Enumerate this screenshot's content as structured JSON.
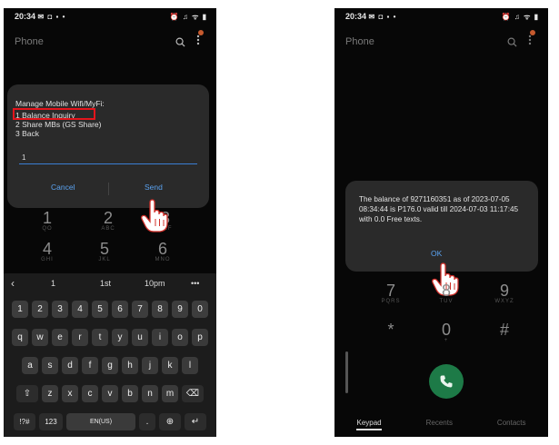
{
  "left": {
    "status": {
      "time": "20:34",
      "left_icons": "✉ ◘ ▪ •",
      "right_icons": "⏰ ♫ ᯤ ▮"
    },
    "app": {
      "title": "Phone"
    },
    "dialog": {
      "title": "Manage Mobile Wifi/MyFi:",
      "options": [
        "1 Balance Inquiry",
        "2 Share MBs (GS Share)",
        "3 Back"
      ],
      "input_value": "1",
      "cancel_label": "Cancel",
      "send_label": "Send"
    },
    "dialpad_visible": [
      {
        "digit": "1",
        "letters": "QO"
      },
      {
        "digit": "2",
        "letters": "ABC"
      },
      {
        "digit": "3",
        "letters": "DEF"
      },
      {
        "digit": "4",
        "letters": "GHI"
      },
      {
        "digit": "5",
        "letters": "JKL"
      },
      {
        "digit": "6",
        "letters": "MNO"
      }
    ],
    "keyboard": {
      "suggestions": [
        "‹",
        "1",
        "1st",
        "10pm",
        "•••"
      ],
      "row_numbers": [
        "1",
        "2",
        "3",
        "4",
        "5",
        "6",
        "7",
        "8",
        "9",
        "0"
      ],
      "row1": [
        "q",
        "w",
        "e",
        "r",
        "t",
        "y",
        "u",
        "i",
        "o",
        "p"
      ],
      "row2": [
        "a",
        "s",
        "d",
        "f",
        "g",
        "h",
        "j",
        "k",
        "l"
      ],
      "row3": [
        "⇧",
        "z",
        "x",
        "c",
        "v",
        "b",
        "n",
        "m",
        "⌫"
      ],
      "row4": [
        "!?#",
        "123",
        "EN(US)",
        ".",
        "⊕",
        "↵"
      ]
    }
  },
  "right": {
    "status": {
      "time": "20:34",
      "left_icons": "✉ ◘ ▪ •",
      "right_icons": "⏰ ♫ ᯤ ▮"
    },
    "app": {
      "title": "Phone"
    },
    "dialog": {
      "message": "The balance of 9271160351 as of 2023-07-05 08:34:44 is P176.0 valid till 2024-07-03 11:17:45 with 0.0 Free texts.",
      "ok_label": "OK"
    },
    "dialpad_visible": [
      {
        "digit": "7",
        "letters": "PQRS"
      },
      {
        "digit": "8",
        "letters": "TUV"
      },
      {
        "digit": "9",
        "letters": "WXYZ"
      },
      {
        "digit": "*",
        "letters": ""
      },
      {
        "digit": "0",
        "letters": "+"
      },
      {
        "digit": "#",
        "letters": ""
      }
    ],
    "tabs": [
      "Keypad",
      "Recents",
      "Contacts"
    ]
  },
  "colors": {
    "accent_blue": "#5aa2f0",
    "highlight_red": "#e3151c",
    "call_green": "#1d7a47"
  }
}
